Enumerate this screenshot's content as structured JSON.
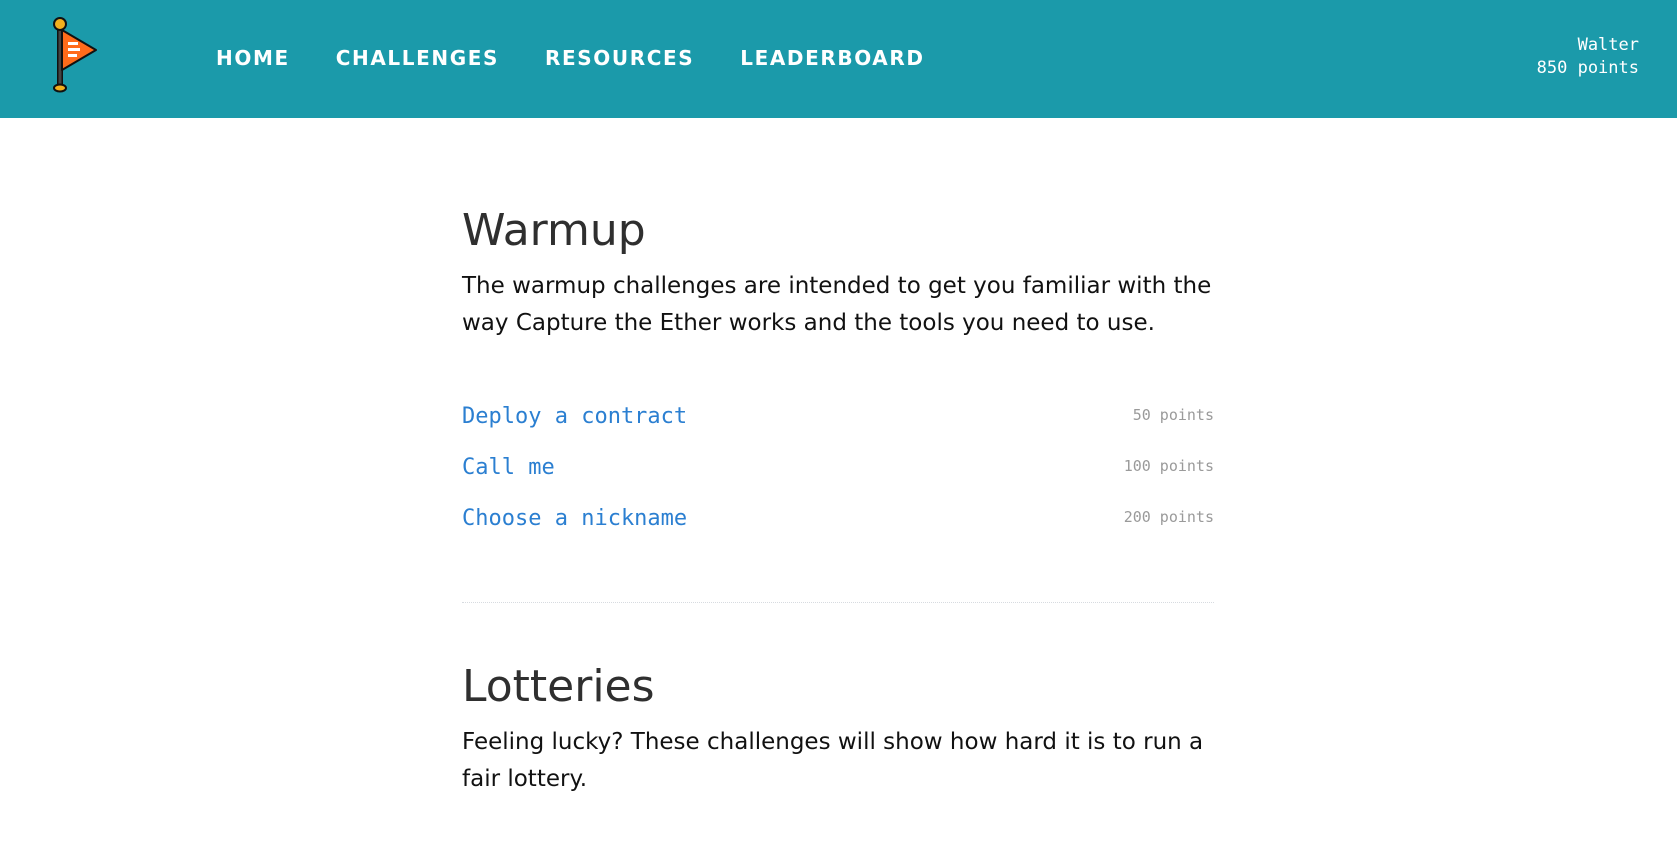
{
  "header": {
    "logo_icon": "orange-flag-logo-icon",
    "nav": [
      {
        "label": "HOME"
      },
      {
        "label": "CHALLENGES"
      },
      {
        "label": "RESOURCES"
      },
      {
        "label": "LEADERBOARD"
      }
    ],
    "user": {
      "name": "Walter",
      "points": "850 points"
    }
  },
  "sections": [
    {
      "title": "Warmup",
      "description": "The warmup challenges are intended to get you familiar with the way Capture the Ether works and the tools you need to use.",
      "challenges": [
        {
          "name": "Deploy a contract",
          "points": "50 points"
        },
        {
          "name": "Call me",
          "points": "100 points"
        },
        {
          "name": "Choose a nickname",
          "points": "200 points"
        }
      ]
    },
    {
      "title": "Lotteries",
      "description": "Feeling lucky? These challenges will show how hard it is to run a fair lottery.",
      "challenges": [
        {
          "name": "",
          "points": ""
        }
      ]
    }
  ],
  "colors": {
    "header_bg": "#1b9aaa",
    "link": "#2b7fd1",
    "muted": "#9a9a9a",
    "flag": "#ff6b1a"
  }
}
